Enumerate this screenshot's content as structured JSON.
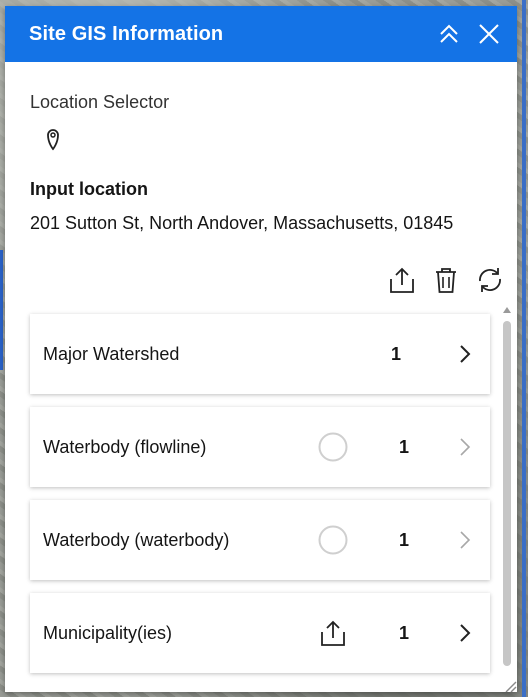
{
  "panel": {
    "title": "Site GIS Information"
  },
  "selector": {
    "label": "Location Selector"
  },
  "input": {
    "label": "Input location",
    "address": "201 Sutton St, North Andover, Massachusetts, 01845"
  },
  "layers": [
    {
      "label": "Major Watershed",
      "count": "1",
      "status": "none"
    },
    {
      "label": "Waterbody (flowline)",
      "count": "1",
      "status": "loading-circle"
    },
    {
      "label": "Waterbody (waterbody)",
      "count": "1",
      "status": "loading-circle"
    },
    {
      "label": "Municipality(ies)",
      "count": "1",
      "status": "export-icon"
    }
  ],
  "colors": {
    "header_bg": "#1473e6",
    "header_text": "#ffffff"
  }
}
